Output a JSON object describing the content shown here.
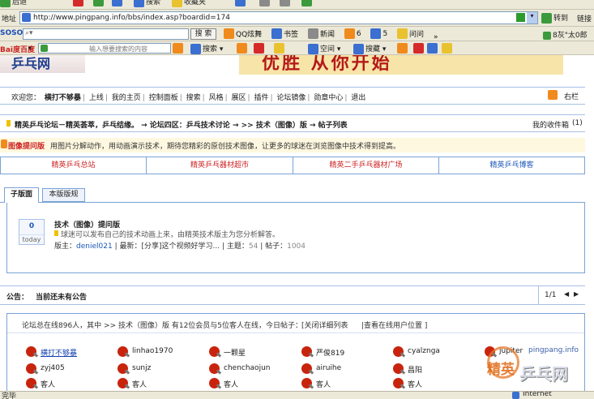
{
  "browser": {
    "top_toolbar": {
      "back_fragment": "后退",
      "search": "搜索",
      "favorites": "收藏夹"
    },
    "address": {
      "label": "地址",
      "url": "http://www.pingpang.info/bbs/index.asp?boardid=174",
      "go": "转到",
      "links": "链接"
    },
    "soso_bar": {
      "logo": "SOSO",
      "search_button": "搜 索",
      "items": [
        "QQ炫舞",
        "书签",
        "新闻",
        "6",
        "5",
        "问问"
      ],
      "more": "»",
      "right_text": "8灰\"太0郎"
    },
    "baidu_bar": {
      "logo": "Bai度百度",
      "search_placeholder": "输入想要搜索的内容",
      "search_button": "搜索",
      "items": [
        "空间",
        "搜藏"
      ]
    },
    "status": {
      "left": "完毕",
      "right": "Internet"
    }
  },
  "banner": {
    "slogan": "优胜  从你开始",
    "logo_text": "乒乓网"
  },
  "user_nav": {
    "welcome": "欢迎您：",
    "items": [
      "横打不够暴",
      "上线",
      "我的主页",
      "控制面板",
      "搜索",
      "风格",
      "展区",
      "插件",
      "论坛镜像",
      "勋章中心",
      "退出"
    ],
    "right": "右栏"
  },
  "breadcrumb": {
    "text": "精英乒乓论坛－精英荟萃，乒乓结缘。 → 论坛四区：乒乓技术讨论 → >> 技术（图像）版 → 帖子列表",
    "inbox": "我的收件箱",
    "inbox_count": "(1)"
  },
  "board_intro": {
    "name": "图像提问版",
    "desc": "用图片分解动作，用动画演示技术，期待您精彩的原创技术图像，让更多的球迷在浏览图像中技术得到提高。"
  },
  "main_links": [
    "精英乒乓总站",
    "精英乒乓器材超市",
    "精英二手乒乓器材广场",
    "精英乒乓博客"
  ],
  "tabs": [
    "子版面",
    "本版版规"
  ],
  "subforum": {
    "today_count": "0",
    "today_label": "today",
    "title": "技术（图像）提问版",
    "desc": "球迷可以发布自己的技术动画上来，由精英技术版主为您分析解答。",
    "moderator_label": "版主：",
    "moderator": "deniel021",
    "latest_label": "| 最新：",
    "latest": "[分享]这个视频好学习...",
    "topics_label": "| 主题：",
    "topics": "54",
    "posts_label": "| 帖子：",
    "posts": "1004"
  },
  "announcement": {
    "label": "公告：",
    "text": "当前还未有公告",
    "page": "1/1",
    "prev": "◀",
    "next": "▶"
  },
  "online": {
    "summary": "论坛总在线896人，其中 >> 技术（图像）版 有12位会员与5位客人在线，今日帖子：",
    "close": "[关闭详细列表",
    "all": "|查看在线用户位置 ]",
    "users": [
      [
        "横打不够暴",
        "linhao1970",
        "一颗星",
        "严俊819",
        "cyalznga",
        "jupiter"
      ],
      [
        "zyj405",
        "sunjz",
        "chenchaojun",
        "airuihe",
        "昌阳",
        ""
      ],
      [
        "客人",
        "客人",
        "客人",
        "客人",
        "客人",
        ""
      ]
    ]
  },
  "watermark": {
    "text1": "精英",
    "text2": "乒乓网",
    "url": "pingpang.info"
  },
  "colors": {
    "accent_blue": "#1a56b8",
    "panel_border": "#7aa3d6",
    "link_red": "#cc2222",
    "header_bg": "#dbe6f7"
  }
}
